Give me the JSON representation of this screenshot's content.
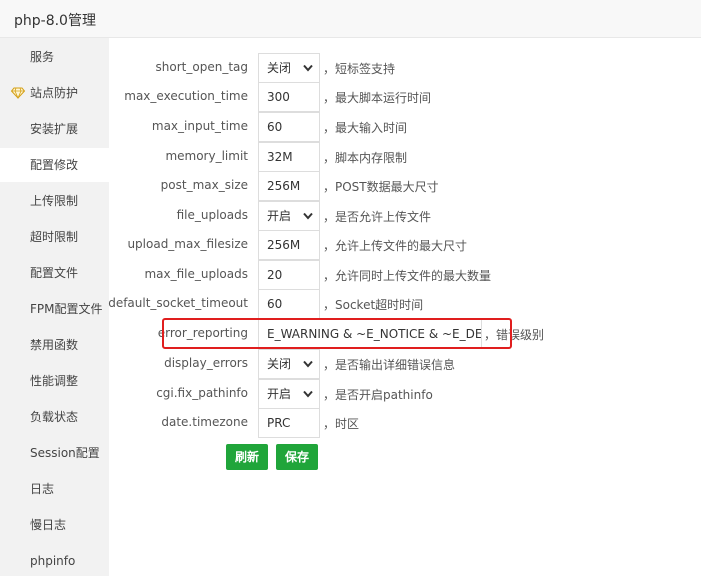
{
  "window": {
    "title": "php-8.0管理"
  },
  "sidebar": {
    "items": [
      {
        "label": "服务"
      },
      {
        "label": "站点防护"
      },
      {
        "label": "安装扩展"
      },
      {
        "label": "配置修改"
      },
      {
        "label": "上传限制"
      },
      {
        "label": "超时限制"
      },
      {
        "label": "配置文件"
      },
      {
        "label": "FPM配置文件"
      },
      {
        "label": "禁用函数"
      },
      {
        "label": "性能调整"
      },
      {
        "label": "负载状态"
      },
      {
        "label": "Session配置"
      },
      {
        "label": "日志"
      },
      {
        "label": "慢日志"
      },
      {
        "label": "phpinfo"
      }
    ],
    "active_item": "配置修改"
  },
  "config": {
    "rows": [
      {
        "name": "short_open_tag",
        "value": "关闭",
        "desc": "，短标签支持"
      },
      {
        "name": "max_execution_time",
        "value": "300",
        "desc": "，最大脚本运行时间"
      },
      {
        "name": "max_input_time",
        "value": "60",
        "desc": "，最大输入时间"
      },
      {
        "name": "memory_limit",
        "value": "32M",
        "desc": "，脚本内存限制"
      },
      {
        "name": "post_max_size",
        "value": "256M",
        "desc": "，POST数据最大尺寸"
      },
      {
        "name": "file_uploads",
        "value": "开启",
        "desc": "，是否允许上传文件"
      },
      {
        "name": "upload_max_filesize",
        "value": "256M",
        "desc": "，允许上传文件的最大尺寸"
      },
      {
        "name": "max_file_uploads",
        "value": "20",
        "desc": "，允许同时上传文件的最大数量"
      },
      {
        "name": "default_socket_timeout",
        "value": "60",
        "desc": "，Socket超时时间"
      },
      {
        "name": "error_reporting",
        "value": "E_WARNING & ~E_NOTICE & ~E_DEPREC",
        "desc": "，错误级别"
      },
      {
        "name": "display_errors",
        "value": "关闭",
        "desc": "，是否输出详细错误信息"
      },
      {
        "name": "cgi.fix_pathinfo",
        "value": "开启",
        "desc": "，是否开启pathinfo"
      },
      {
        "name": "date.timezone",
        "value": "PRC",
        "desc": "，时区"
      }
    ]
  },
  "buttons": {
    "refresh": "刷新",
    "save": "保存"
  },
  "colors": {
    "accent": "#20a53a",
    "highlight": "#e01e1e"
  }
}
